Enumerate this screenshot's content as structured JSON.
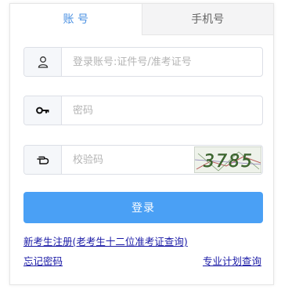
{
  "tabs": [
    {
      "label": "账 号",
      "active": true
    },
    {
      "label": "手机号",
      "active": false
    }
  ],
  "form": {
    "account_placeholder": "登录账号:证件号/准考证号",
    "password_placeholder": "密码",
    "captcha_placeholder": "校验码",
    "captcha_text": "3785",
    "login_label": "登录"
  },
  "links": {
    "register": "新考生注册(老考生十二位准考证查询)",
    "forgot": "忘记密码",
    "plan": "专业计划查询"
  },
  "colors": {
    "accent": "#4a90e2",
    "button": "#4aa0f5",
    "link": "#1a1aa6"
  }
}
